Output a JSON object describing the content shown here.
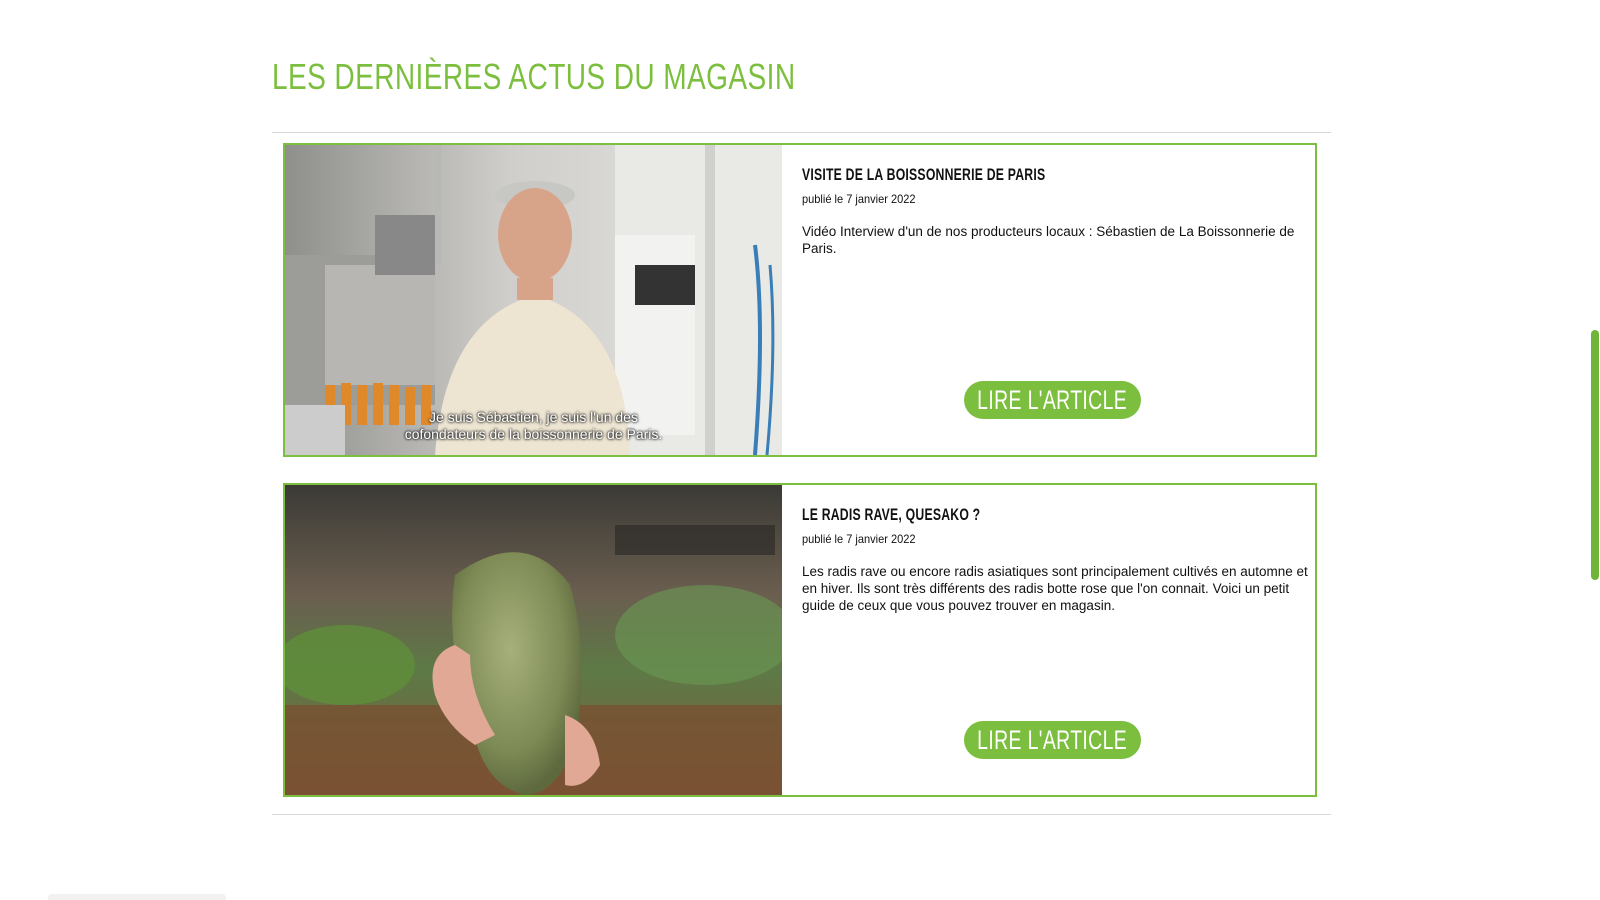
{
  "section": {
    "title": "Les dernières actus du magasin"
  },
  "articles": [
    {
      "title": "Visite de la Boissonnerie de Paris",
      "date": "publié le 7 janvier 2022",
      "description": "Vidéo Interview d'un de nos producteurs locaux : Sébastien de La Boissonnerie de Paris.",
      "subtitle_line1": "Je suis Sébastien, je suis l'un des",
      "subtitle_line2": "cofondateurs de la boissonnerie de Paris.",
      "button": "Lire l'article"
    },
    {
      "title": "Le radis rave, quesako ?",
      "date": "publié le 7 janvier 2022",
      "description": "Les radis rave ou encore radis asiatiques sont principalement cultivés en automne et en hiver. Ils sont très différents des radis botte rose que l'on connait. Voici un petit guide de ceux que vous pouvez trouver en magasin.",
      "button": "Lire l'article"
    }
  ],
  "colors": {
    "accent": "#7cbf3f",
    "text": "#111111"
  }
}
